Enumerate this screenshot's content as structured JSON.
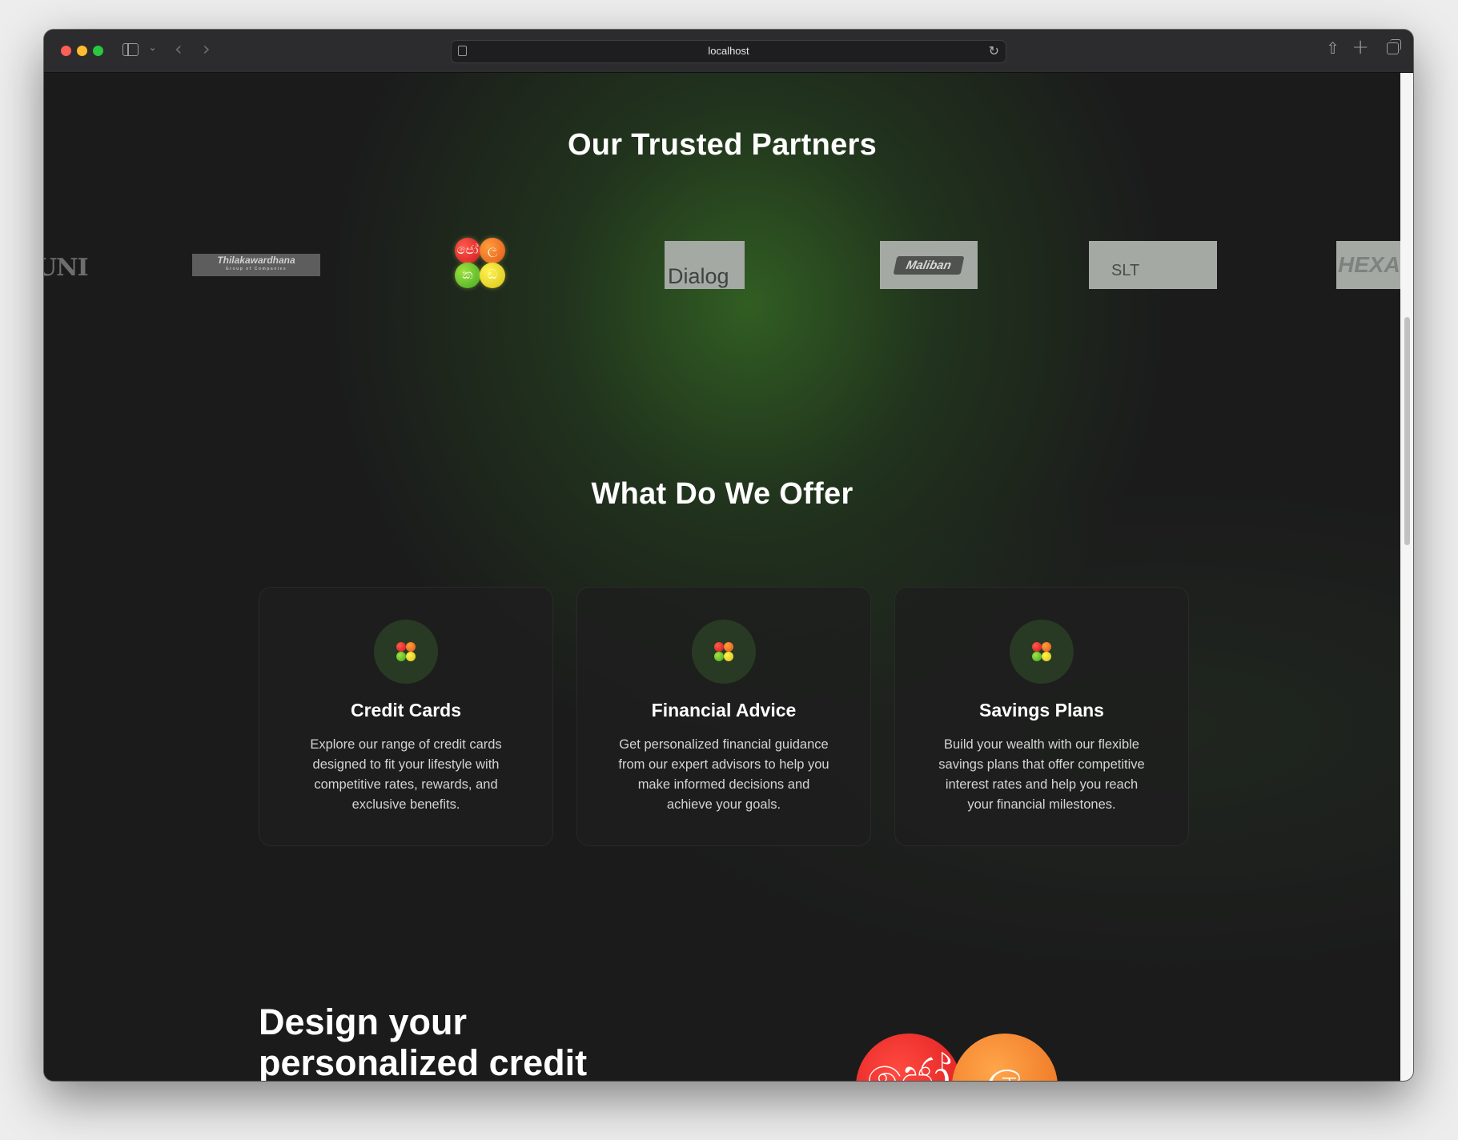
{
  "browser": {
    "url": "localhost",
    "icons": [
      "sidebar-icon",
      "chevron-down-icon",
      "back-icon",
      "forward-icon",
      "page-icon",
      "reload-icon",
      "share-icon",
      "plus-icon",
      "tabs-icon"
    ]
  },
  "partners": {
    "title": "Our Trusted Partners",
    "logos": [
      {
        "name": "UNI",
        "text": "UNI"
      },
      {
        "name": "Thilakawardhana",
        "text": "Thilakawardhana",
        "subtext": "Group of Companies"
      },
      {
        "name": "balls-logo",
        "glyphs": [
          "ජෝ",
          "ල",
          "ක",
          "ඩ"
        ]
      },
      {
        "name": "Dialog",
        "text": "Dialog"
      },
      {
        "name": "Maliban",
        "text": "Maliban"
      },
      {
        "name": "SLT",
        "text": "SLT"
      },
      {
        "name": "Hexa",
        "text": "HEXA"
      }
    ]
  },
  "offer": {
    "title": "What Do We Offer",
    "cards": [
      {
        "title": "Credit Cards",
        "description": "Explore our range of credit cards designed to fit your lifestyle with competitive rates, rewards, and exclusive benefits."
      },
      {
        "title": "Financial Advice",
        "description": "Get personalized financial guidance from our expert advisors to help you make informed decisions and achieve your goals."
      },
      {
        "title": "Savings Plans",
        "description": "Build your wealth with our flexible savings plans that offer competitive interest rates and help you reach your financial milestones."
      }
    ]
  },
  "design": {
    "title": "Design your personalized credit card",
    "glyphs": [
      "ජෝ",
      "ල"
    ]
  },
  "colors": {
    "background": "#1b1b1c",
    "glow": "#366e24",
    "ball_red": "#d0141b",
    "ball_orange": "#e2561a",
    "ball_green": "#3ea823",
    "ball_yellow": "#d7c41a"
  }
}
